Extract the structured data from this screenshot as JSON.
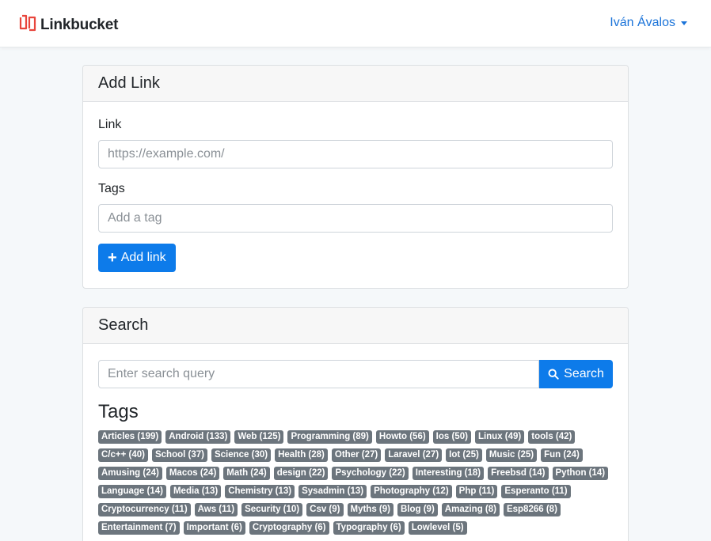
{
  "app": {
    "name": "Linkbucket"
  },
  "user": {
    "name": "Iván Ávalos"
  },
  "add_link": {
    "title": "Add Link",
    "link_label": "Link",
    "link_placeholder": "https://example.com/",
    "tags_label": "Tags",
    "tags_placeholder": "Add a tag",
    "button_label": "Add link"
  },
  "search": {
    "title": "Search",
    "placeholder": "Enter search query",
    "button_label": "Search",
    "tags_heading": "Tags",
    "tags": [
      "Articles (199)",
      "Android (133)",
      "Web (125)",
      "Programming (89)",
      "Howto (56)",
      "Ios (50)",
      "Linux (49)",
      "tools (42)",
      "C/c++ (40)",
      "School (37)",
      "Science (30)",
      "Health (28)",
      "Other (27)",
      "Laravel (27)",
      "Iot (25)",
      "Music (25)",
      "Fun (24)",
      "Amusing (24)",
      "Macos (24)",
      "Math (24)",
      "design (22)",
      "Psychology (22)",
      "Interesting (18)",
      "Freebsd (14)",
      "Python (14)",
      "Language (14)",
      "Media (13)",
      "Chemistry (13)",
      "Sysadmin (13)",
      "Photography (12)",
      "Php (11)",
      "Esperanto (11)",
      "Cryptocurrency (11)",
      "Aws (11)",
      "Security (10)",
      "Csv (9)",
      "Myths (9)",
      "Blog (9)",
      "Amazing (8)",
      "Esp8266 (8)",
      "Entertainment (7)",
      "Important (6)",
      "Cryptography (6)",
      "Typography (6)",
      "Lowlevel (5)"
    ]
  },
  "colors": {
    "primary": "#0d7bea",
    "tag_bg": "#6c757d",
    "brand_icon": "#e8453c",
    "link": "#1a73d9"
  }
}
